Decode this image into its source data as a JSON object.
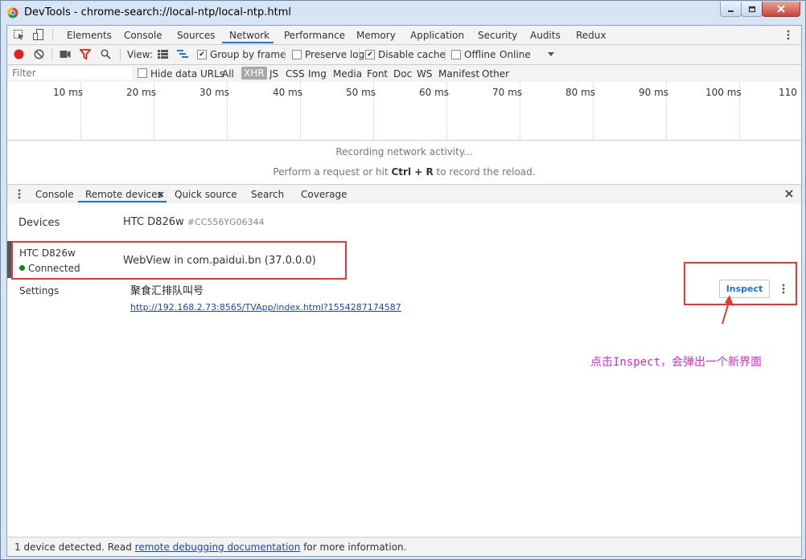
{
  "window": {
    "title": "DevTools - chrome-search://local-ntp/local-ntp.html",
    "controls": [
      "minimize",
      "restore",
      "close"
    ]
  },
  "main_tabs": [
    "Elements",
    "Console",
    "Sources",
    "Network",
    "Performance",
    "Memory",
    "Application",
    "Security",
    "Audits",
    "Redux"
  ],
  "active_main_tab": "Network",
  "network_toolbar": {
    "view_label": "View:",
    "group_by_frame": {
      "label": "Group by frame",
      "checked": true
    },
    "preserve_log": {
      "label": "Preserve log",
      "checked": false
    },
    "disable_cache": {
      "label": "Disable cache",
      "checked": true
    },
    "offline": {
      "label": "Offline",
      "checked": false
    },
    "throttling": "Online"
  },
  "filter_bar": {
    "placeholder": "Filter",
    "hide_data_urls": {
      "label": "Hide data URLs",
      "checked": false
    },
    "types": [
      "All",
      "XHR",
      "JS",
      "CSS",
      "Img",
      "Media",
      "Font",
      "Doc",
      "WS",
      "Manifest",
      "Other"
    ],
    "active_type": "XHR"
  },
  "overview_ticks": [
    "10 ms",
    "20 ms",
    "30 ms",
    "40 ms",
    "50 ms",
    "60 ms",
    "70 ms",
    "80 ms",
    "90 ms",
    "100 ms",
    "110"
  ],
  "empty_state": {
    "line1": "Recording network activity...",
    "line2_prefix": "Perform a request or hit ",
    "shortcut": "Ctrl + R",
    "line2_suffix": " to record the reload."
  },
  "drawer_tabs": [
    "Console",
    "Remote devices",
    "Quick source",
    "Search",
    "Coverage"
  ],
  "active_drawer_tab": "Remote devices",
  "remote_devices": {
    "devices_label": "Devices",
    "device_header": "HTC D826w",
    "device_serial": "#CC556YG06344",
    "device_name": "HTC D826w",
    "device_status": "Connected",
    "webview": "WebView in com.paidui.bn (37.0.0.0)",
    "settings_label": "Settings",
    "page_title": "聚食汇排队叫号",
    "page_url": "http://192.168.2.73:8565/TVApp/index.html?1554287174587",
    "inspect_label": "Inspect"
  },
  "annotation": "点击Inspect，会弹出一个新界面",
  "status": {
    "prefix": "1 device detected. Read ",
    "link": "remote debugging documentation",
    "suffix": " for more information."
  },
  "colors": {
    "accent": "#1a73e8",
    "annotation": "#d62bd6",
    "highlight_box": "#e53935",
    "connected": "#0a8a0a"
  }
}
